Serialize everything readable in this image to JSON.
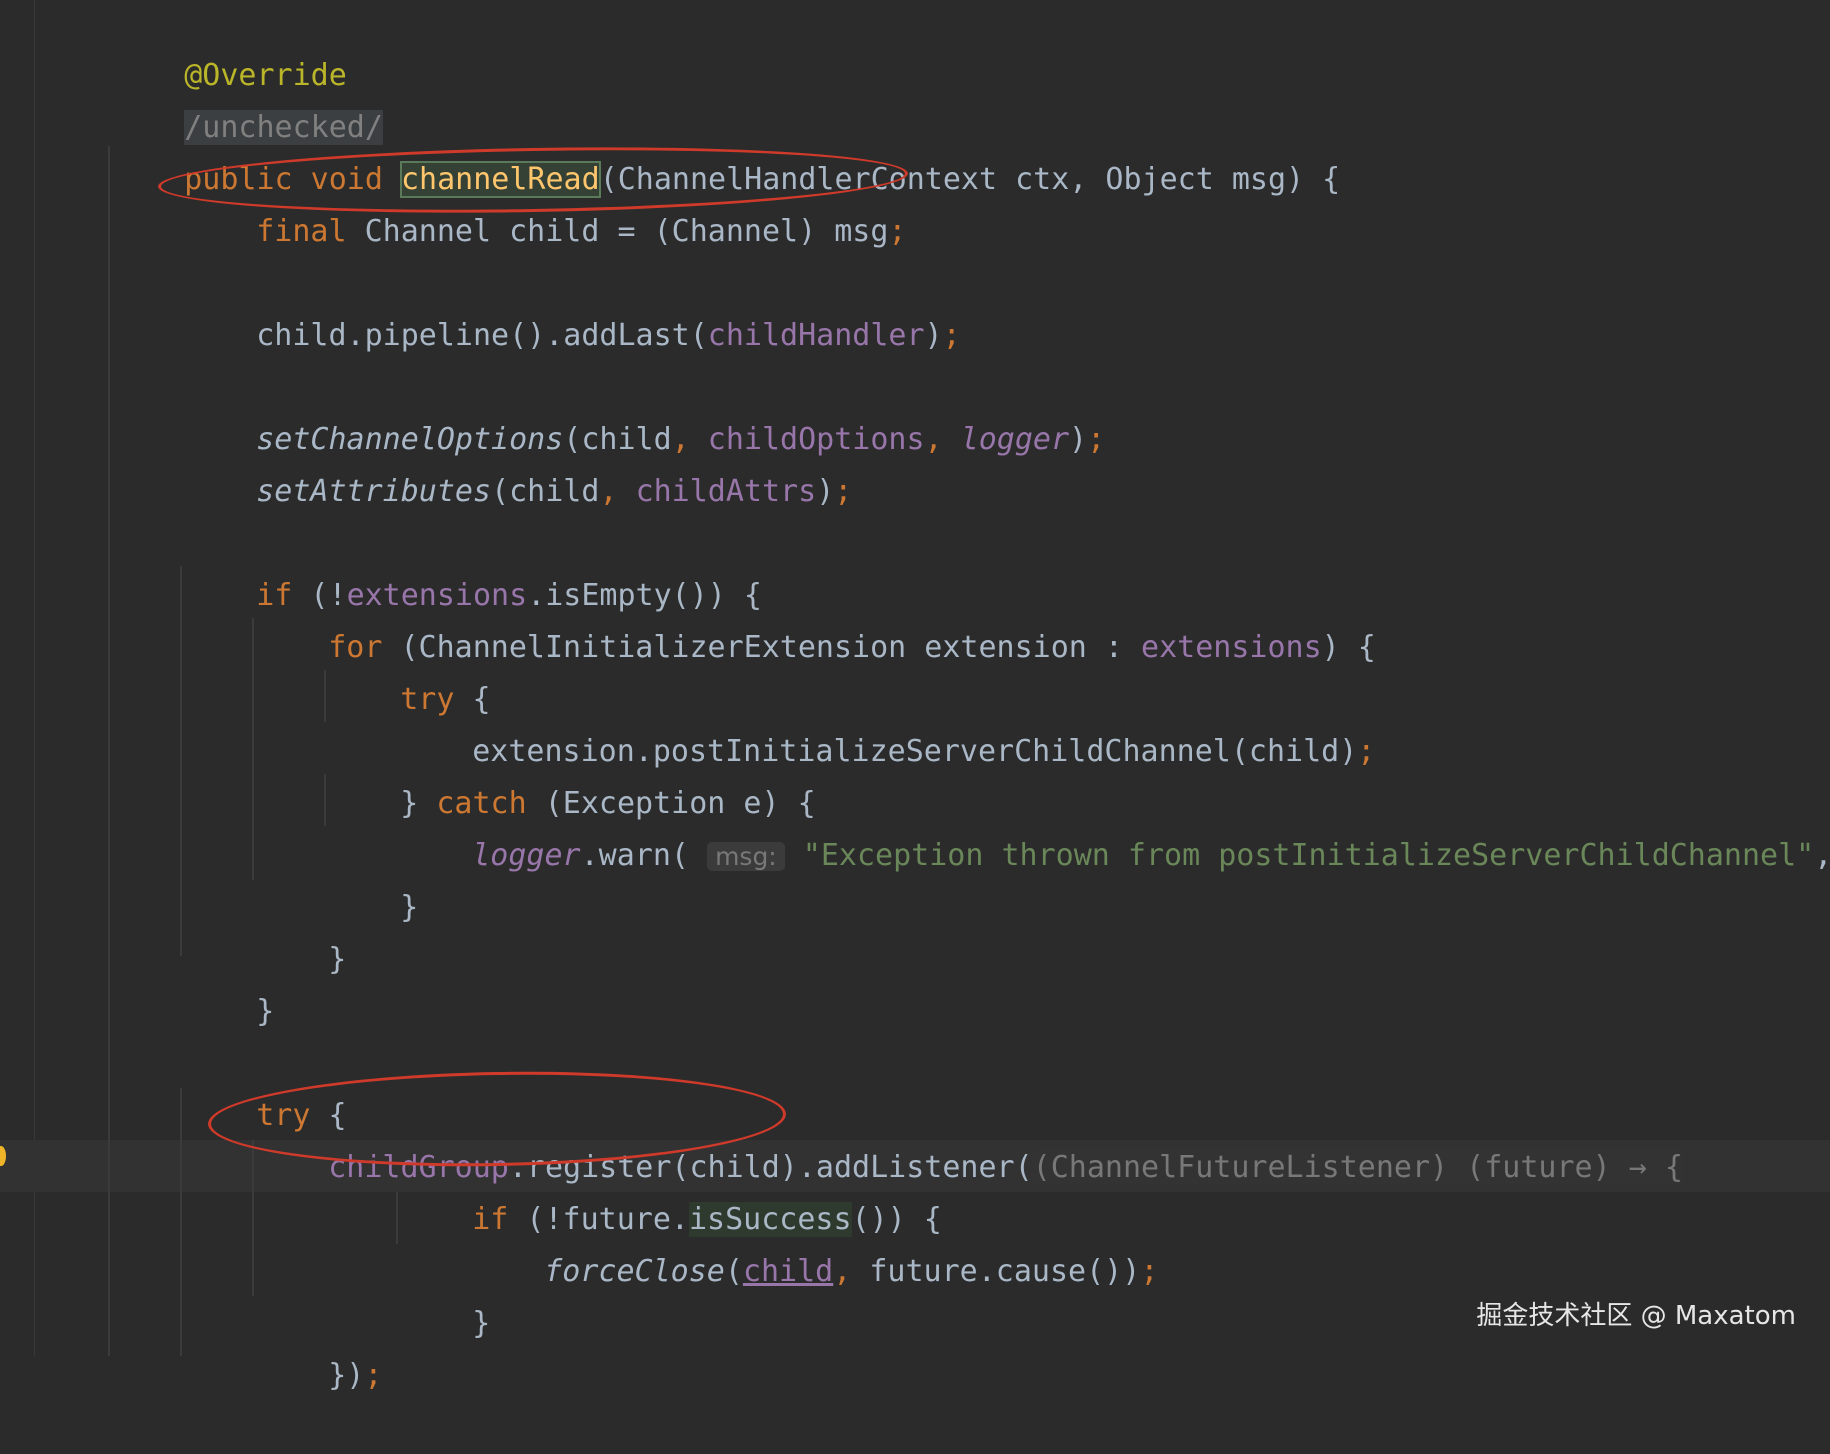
{
  "code": {
    "annotation": "@Override",
    "suppress_comment": "/unchecked/",
    "sig_modifiers": "public void ",
    "sig_method": "channelRead",
    "sig_params": "(ChannelHandlerContext ctx, Object msg) {",
    "l4_kw": "final",
    "l4_rest": " Channel child = (Channel) msg",
    "semicolon": ";",
    "l6_a": "child.pipeline().addLast(",
    "l6_field": "childHandler",
    "l6_close": ")",
    "l8_call": "setChannelOptions",
    "l8_open": "(child",
    "comma": ", ",
    "l8_field": "childOptions",
    "l8_logger": "logger",
    "l8_close": ")",
    "l9_call": "setAttributes",
    "l9_open": "(child",
    "l9_field": "childAttrs",
    "l9_close": ")",
    "if_kw": "if",
    "l11_a": " (!",
    "l11_field": "extensions",
    "l11_b": ".isEmpty()) {",
    "for_kw": "for",
    "l12_a": " (ChannelInitializerExtension extension : ",
    "l12_field": "extensions",
    "l12_b": ") {",
    "try_kw": "try",
    "brace_open": " {",
    "l14_a": "extension.postInitializeServerChildChannel(child)",
    "brace_close_pre": "} ",
    "catch_kw": "catch",
    "l15_a": " (Exception e) {",
    "l16_logger": "logger",
    "l16_a": ".warn(",
    "l16_hint": "msg:",
    "l16_str": "\"Exception thrown from postInitializeServerChildChannel\"",
    "l16_b": ", e)",
    "brace_close": "}",
    "l22_field": "childGroup",
    "l22_a": ".register(child).addListener(",
    "l22_hint": "(ChannelFutureListener) (future) → {",
    "l23_a": " (!future.",
    "l23_call": "isSuccess",
    "l23_b": "()) {",
    "l24_call": "forceClose",
    "l24_open": "(",
    "l24_child": "child",
    "l24_b": "future.cause())",
    "l26_a": "})"
  },
  "watermark": "掘金技术社区 @ Maxatom"
}
